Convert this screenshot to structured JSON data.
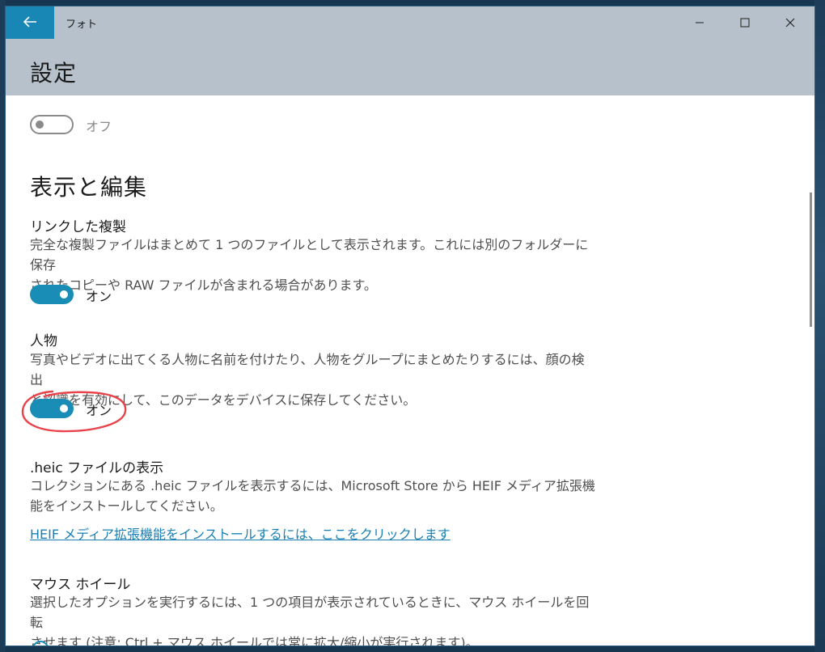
{
  "window": {
    "app_title": "フォト",
    "controls": {
      "minimize": "minimize",
      "maximize": "maximize",
      "close": "close"
    }
  },
  "header": {
    "title": "設定"
  },
  "top_toggle": {
    "state": "off",
    "label": "オフ"
  },
  "section": {
    "heading": "表示と編集"
  },
  "settings": [
    {
      "title": "リンクした複製",
      "desc_lines": [
        "完全な複製ファイルはまとめて 1 つのファイルとして表示されます。これには別のフォルダーに保存",
        "されたコピーや RAW ファイルが含まれる場合があります。"
      ],
      "toggle": {
        "state": "on",
        "label": "オン"
      }
    },
    {
      "title": "人物",
      "desc_lines": [
        "写真やビデオに出てくる人物に名前を付けたり、人物をグループにまとめたりするには、顔の検出",
        "と認識を有効にして、このデータをデバイスに保存してください。"
      ],
      "toggle": {
        "state": "on",
        "label": "オン"
      }
    },
    {
      "title": ".heic ファイルの表示",
      "desc_lines": [
        "コレクションにある .heic ファイルを表示するには、Microsoft Store から HEIF メディア拡張機",
        "能をインストールしてください。"
      ],
      "link": "HEIF メディア拡張機能をインストールするには、ここをクリックします"
    },
    {
      "title": "マウス ホイール",
      "desc_lines": [
        "選択したオプションを実行するには、1 つの項目が表示されているときに、マウス ホイールを回転",
        "させます (注意: Ctrl + マウス ホイールでは常に拡大/縮小が実行されます)。"
      ]
    }
  ],
  "colors": {
    "accent": "#1a8db7",
    "link": "#1a7fb5",
    "header_bg": "#b7c1cc",
    "annotation": "#e8424a"
  }
}
